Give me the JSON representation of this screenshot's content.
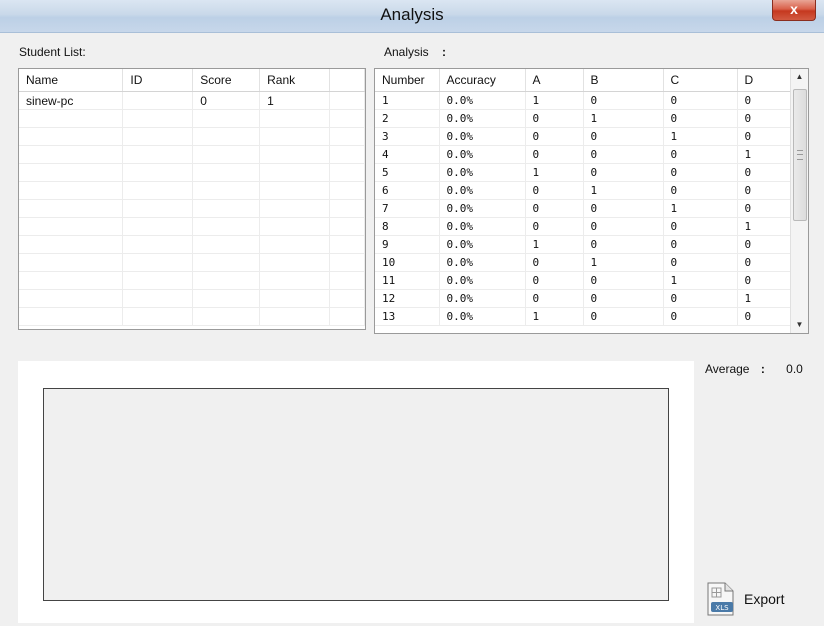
{
  "window": {
    "title": "Analysis",
    "close_label": "x"
  },
  "student_list": {
    "label": "Student List:",
    "columns": [
      "Name",
      "ID",
      "Score",
      "Rank"
    ],
    "rows": [
      [
        "sinew-pc",
        "",
        "0",
        "1"
      ],
      [
        "",
        "",
        "",
        ""
      ],
      [
        "",
        "",
        "",
        ""
      ],
      [
        "",
        "",
        "",
        ""
      ],
      [
        "",
        "",
        "",
        ""
      ],
      [
        "",
        "",
        "",
        ""
      ],
      [
        "",
        "",
        "",
        ""
      ],
      [
        "",
        "",
        "",
        ""
      ],
      [
        "",
        "",
        "",
        ""
      ],
      [
        "",
        "",
        "",
        ""
      ],
      [
        "",
        "",
        "",
        ""
      ],
      [
        "",
        "",
        "",
        ""
      ],
      [
        "",
        "",
        "",
        ""
      ]
    ]
  },
  "analysis": {
    "label": "Analysis",
    "colon": ":",
    "columns": [
      "Number",
      "Accuracy",
      "A",
      "B",
      "C",
      "D"
    ],
    "rows": [
      [
        "1",
        "0.0%",
        "1",
        "0",
        "0",
        "0"
      ],
      [
        "2",
        "0.0%",
        "0",
        "1",
        "0",
        "0"
      ],
      [
        "3",
        "0.0%",
        "0",
        "0",
        "1",
        "0"
      ],
      [
        "4",
        "0.0%",
        "0",
        "0",
        "0",
        "1"
      ],
      [
        "5",
        "0.0%",
        "1",
        "0",
        "0",
        "0"
      ],
      [
        "6",
        "0.0%",
        "0",
        "1",
        "0",
        "0"
      ],
      [
        "7",
        "0.0%",
        "0",
        "0",
        "1",
        "0"
      ],
      [
        "8",
        "0.0%",
        "0",
        "0",
        "0",
        "1"
      ],
      [
        "9",
        "0.0%",
        "1",
        "0",
        "0",
        "0"
      ],
      [
        "10",
        "0.0%",
        "0",
        "1",
        "0",
        "0"
      ],
      [
        "11",
        "0.0%",
        "0",
        "0",
        "1",
        "0"
      ],
      [
        "12",
        "0.0%",
        "0",
        "0",
        "0",
        "1"
      ],
      [
        "13",
        "0.0%",
        "1",
        "0",
        "0",
        "0"
      ]
    ]
  },
  "average": {
    "label": "Average",
    "colon": ":",
    "value": "0.0"
  },
  "export": {
    "label": "Export",
    "icon": "xls-file-icon",
    "icon_text": "XLS"
  },
  "colors": {
    "title_bar": "#c9d8e9",
    "close_button": "#c5381f"
  }
}
